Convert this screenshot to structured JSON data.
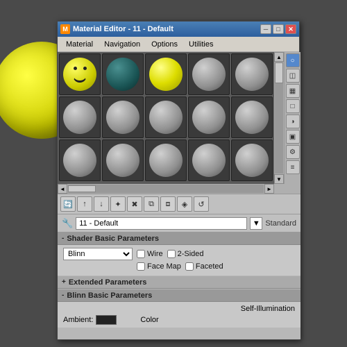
{
  "window": {
    "title": "Material Editor - 11 - Default",
    "icon": "M"
  },
  "menubar": {
    "items": [
      "Material",
      "Navigation",
      "Options",
      "Utilities"
    ]
  },
  "titlebar": {
    "min_btn": "─",
    "max_btn": "□",
    "close_btn": "✕"
  },
  "grid": {
    "h_scroll_left": "◄",
    "h_scroll_right": "►",
    "v_scroll_up": "▲",
    "v_scroll_down": "▼"
  },
  "right_icons": [
    {
      "name": "sphere-icon",
      "symbol": "○"
    },
    {
      "name": "cylinder-icon",
      "symbol": "◫"
    },
    {
      "name": "checker-icon",
      "symbol": "▦"
    },
    {
      "name": "square-icon",
      "symbol": "□"
    },
    {
      "name": "backlight-icon",
      "symbol": "◑"
    },
    {
      "name": "bg-icon",
      "symbol": "▣"
    },
    {
      "name": "settings-icon",
      "symbol": "⚙"
    },
    {
      "name": "link-icon",
      "symbol": "⛓"
    }
  ],
  "toolbar": {
    "tools": [
      {
        "name": "pick-material",
        "symbol": "🔄"
      },
      {
        "name": "get-material",
        "symbol": "↑"
      },
      {
        "name": "put-to-scene",
        "symbol": "↓"
      },
      {
        "name": "assign",
        "symbol": "✦"
      },
      {
        "name": "delete",
        "symbol": "✖"
      },
      {
        "name": "copy",
        "symbol": "⧉"
      },
      {
        "name": "paste",
        "symbol": "⧈"
      },
      {
        "name": "make-unique",
        "symbol": "◈"
      },
      {
        "name": "reset",
        "symbol": "↺"
      }
    ]
  },
  "namebar": {
    "material_name": "11 - Default",
    "material_type": "Standard",
    "dropdown_arrow": "▼",
    "eyedropper": "💉"
  },
  "shader_section": {
    "header": "Shader Basic Parameters",
    "collapse_icon": "-",
    "shader_type": "Blinn",
    "checkboxes": [
      {
        "label": "Wire",
        "checked": false
      },
      {
        "label": "2-Sided",
        "checked": false
      },
      {
        "label": "Face Map",
        "checked": false
      },
      {
        "label": "Faceted",
        "checked": false
      }
    ]
  },
  "extended_section": {
    "header": "Extended Parameters",
    "collapse_icon": "+"
  },
  "blinn_section": {
    "header": "Blinn Basic Parameters",
    "collapse_icon": "-",
    "self_illumination_label": "Self-Illumination",
    "ambient_label": "Ambient:",
    "color_label": "Color"
  }
}
